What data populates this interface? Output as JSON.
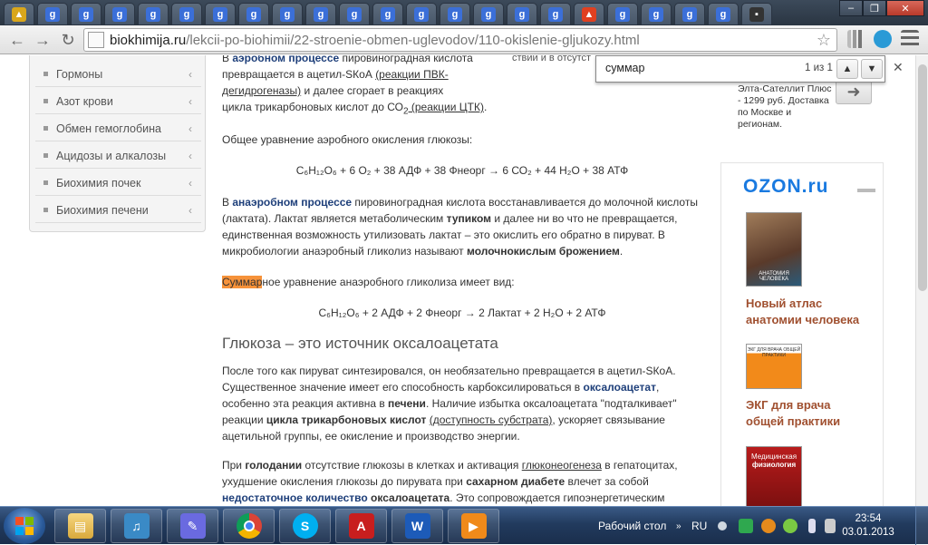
{
  "browser": {
    "url_domain": "biokhimija.ru",
    "url_path": "/lekcii-po-biohimii/22-stroenie-obmen-uglevodov/110-okislenie-gljukozy.html"
  },
  "sidebar": {
    "items": [
      {
        "label": "Гормоны"
      },
      {
        "label": "Азот крови"
      },
      {
        "label": "Обмен гемоглобина"
      },
      {
        "label": "Ацидозы и алкалозы"
      },
      {
        "label": "Биохимия почек"
      },
      {
        "label": "Биохимия печени"
      }
    ]
  },
  "article": {
    "p1_l1a": "В ",
    "p1_l1b": "аэробном процессе",
    "p1_l1c": " пировиноградная кислота",
    "p1_l2a": "превращается в ацетил-SКоА ",
    "p1_l2b": "(реакции ПВК-",
    "p1_l3a": "дегидрогеназы)",
    "p1_l3b": " и далее сгорает в реакциях",
    "p1_l4a": "цикла трикарбоновых кислот до СО",
    "p1_l4sub": "2",
    "p1_l4b": " (реакции ЦТК)",
    "p1_l4c": ".",
    "p2": "Общее уравнение аэробного окисления глюкозы:",
    "eq1": "C₆H₁₂O₆ + 6 O₂ + 38 АДФ + 38 Фнеорг → 6 СО₂ + 44 H₂O + 38 АТФ",
    "p3_l1a": "В ",
    "p3_l1b": "анаэробном процессе",
    "p3_l1c": " пировиноградная кислота восстанавливается до молочной кислоты",
    "p3_l2a": "(лактата). Лактат является метаболическим ",
    "p3_l2b": "тупиком",
    "p3_l2c": " и далее ни во что не превращается,",
    "p3_l3": "единственная возможность утилизовать лактат – это окислить его обратно в пируват. В",
    "p3_l4a": "микробиологии анаэробный гликолиз называют ",
    "p3_l4b": "молочнокислым брожением",
    "p3_l4c": ".",
    "p4_hl": "Суммар",
    "p4_rest": "ное уравнение анаэробного гликолиза имеет вид:",
    "eq2": "C₆H₁₂O₆ + 2 АДФ + 2 Фнеорг → 2 Лактат + 2 H₂O + 2 АТФ",
    "h2": "Глюкоза – это источник оксалоацетата",
    "p5_l1": "После того как пируват синтезировался, он необязательно превращается в ацетил-SКоА.",
    "p5_l2a": "Существенное значение имеет его способность карбоксилироваться в ",
    "p5_l2b": "оксалоацетат",
    "p5_l2c": ",",
    "p5_l3a": "особенно эта реакция активна в ",
    "p5_l3b": "печени",
    "p5_l3c": ". Наличие избытка оксалоацетата \"подталкивает\"",
    "p5_l4a": "реакции ",
    "p5_l4b": "цикла трикарбоновых кислот",
    "p5_l4c": " ",
    "p5_l4d": "(доступность субстрата)",
    "p5_l4e": ", ускоряет связывание",
    "p5_l5": "ацетильной группы, ее окисление и производство энергии.",
    "p6_l1a": "При ",
    "p6_l1b": "голодании",
    "p6_l1c": " отсутствие глюкозы в клетках и активация ",
    "p6_l1d": "глюконеогенеза",
    "p6_l1e": " в гепатоцитах,",
    "p6_l2a": "ухудшение окисления глюкозы до пирувата при ",
    "p6_l2b": "сахарном диабете",
    "p6_l2c": " влечет за собой",
    "p6_l3a": "недостаточное количество",
    "p6_l3b": " ",
    "p6_l3c": "оксалоацетата",
    "p6_l3d": ". Это сопровождается гипоэнергетическим"
  },
  "right": {
    "top_snip": "ствии и в отсутст",
    "ad_l1": "Элта-Сателлит Плюс",
    "ad_l2": "- 1299 руб. Доставка",
    "ad_l3": "по Москве и",
    "ad_l4": "регионам.",
    "ozon_logo": "OZON.ru",
    "book1_l1": "Новый атлас",
    "book1_l2": "анатомии человека",
    "book2_l1": "ЭКГ для врача",
    "book2_l2": "общей практики",
    "book1_cover": "АНАТОМИЯ ЧЕЛОВЕКА",
    "book2_cover": "ЭКГ ДЛЯ ВРАЧА ОБЩЕЙ ПРАКТИКИ",
    "book3_cover_l1": "Медицинская",
    "book3_cover_l2": "физиология"
  },
  "findbar": {
    "query": "суммар",
    "count": "1 из 1"
  },
  "taskbar": {
    "desktop_label": "Рабочий стол",
    "lang": "RU",
    "time": "23:54",
    "date": "03.01.2013"
  },
  "colors": {
    "accent_link": "#1e3f7a",
    "highlight": "#f6923a",
    "book_title": "#a05030"
  }
}
